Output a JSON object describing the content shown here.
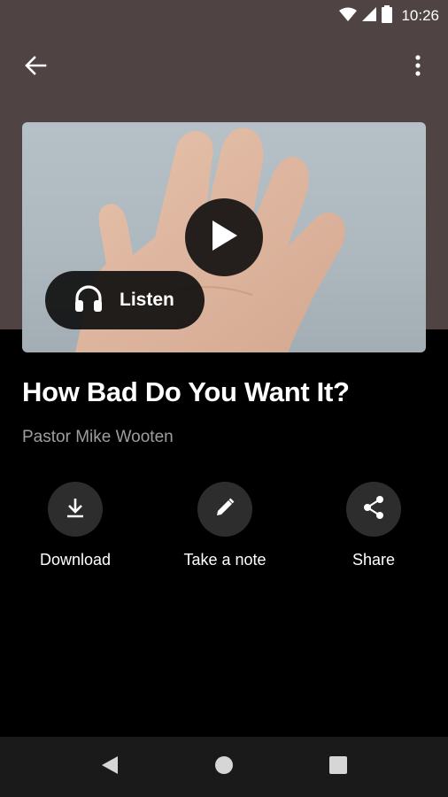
{
  "status_bar": {
    "time": "10:26"
  },
  "hero": {
    "listen_label": "Listen"
  },
  "sermon": {
    "title": "How Bad Do You Want It?",
    "speaker": "Pastor Mike Wooten"
  },
  "actions": [
    {
      "label": "Download",
      "icon": "download-icon"
    },
    {
      "label": "Take a note",
      "icon": "pencil-icon"
    },
    {
      "label": "Share",
      "icon": "share-icon"
    }
  ],
  "colors": {
    "header_bg": "#4f4443",
    "page_bg": "#000000",
    "action_circle_bg": "#2d2d2d",
    "subtitle_text": "#9e9e9e",
    "nav_bar_bg": "#1a1a1a"
  }
}
